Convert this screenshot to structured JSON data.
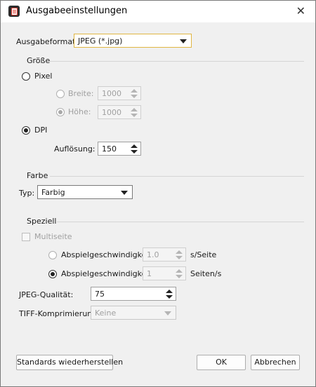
{
  "window": {
    "title": "Ausgabeeinstellungen",
    "close_glyph": "✕"
  },
  "output_format": {
    "label": "Ausgabeformat:",
    "value": "JPEG (*.jpg)"
  },
  "size_group": {
    "title": "Größe",
    "pixel_label": "Pixel",
    "width_label": "Breite:",
    "width_value": "1000",
    "height_label": "Höhe:",
    "height_value": "1000",
    "dpi_label": "DPI",
    "resolution_label": "Auflösung:",
    "resolution_value": "150"
  },
  "color_group": {
    "title": "Farbe",
    "type_label": "Typ:",
    "type_value": "Farbig"
  },
  "special_group": {
    "title": "Speziell",
    "multipage_label": "Multiseite",
    "speed1_label": "Abspielgeschwindigkeit:",
    "speed1_value": "1.0",
    "speed1_unit": "s/Seite",
    "speed2_label": "Abspielgeschwindigkeit:",
    "speed2_value": "1",
    "speed2_unit": "Seiten/s",
    "jpeg_quality_label": "JPEG-Qualität:",
    "jpeg_quality_value": "75",
    "tiff_label": "TIFF-Komprimierung:",
    "tiff_value": "Keine"
  },
  "buttons": {
    "restore": "Standards wiederherstellen",
    "ok": "OK",
    "cancel": "Abbrechen"
  }
}
